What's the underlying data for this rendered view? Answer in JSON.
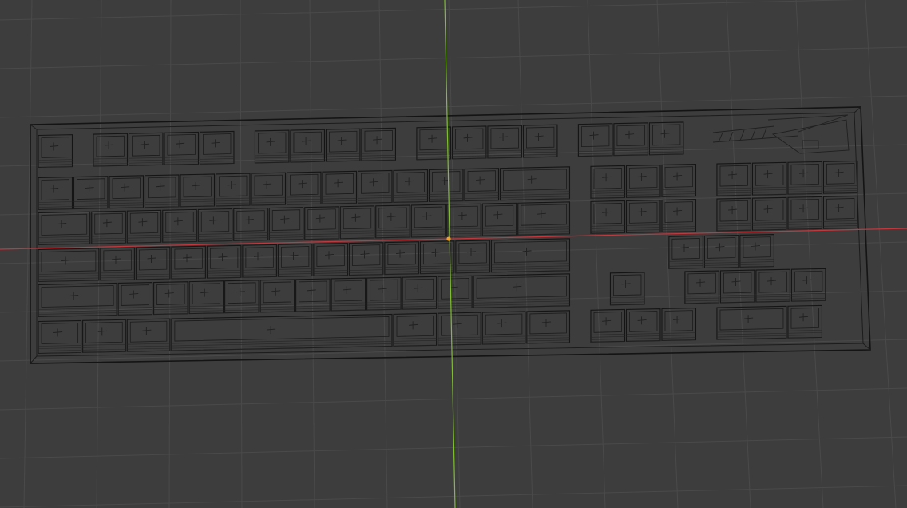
{
  "viewport": {
    "mode": "wireframe",
    "background": "#3d3d3d",
    "grid_color": "#4a4a4a",
    "wire_color": "#151515",
    "axis_x_color": "#c0393f",
    "axis_y_color": "#7fbf2f",
    "origin_color": "#f0a030"
  },
  "model": {
    "object": "keyboard",
    "rows": [
      [
        1,
        0,
        1,
        1,
        1,
        1,
        0,
        1,
        1,
        1,
        1,
        0,
        1,
        1,
        1,
        1,
        0,
        1,
        1,
        1
      ],
      [
        1,
        1,
        1,
        1,
        1,
        1,
        1,
        1,
        1,
        1,
        1,
        1,
        1,
        2,
        0,
        1,
        1,
        1,
        0,
        1,
        1,
        1,
        1
      ],
      [
        1.5,
        1,
        1,
        1,
        1,
        1,
        1,
        1,
        1,
        1,
        1,
        1,
        1,
        1.5,
        0,
        1,
        1,
        1,
        0,
        1,
        1,
        1,
        1
      ],
      [
        1.75,
        1,
        1,
        1,
        1,
        1,
        1,
        1,
        1,
        1,
        1,
        1,
        2.25,
        0,
        0,
        0,
        0,
        0,
        1,
        1,
        1,
        0
      ],
      [
        2.25,
        1,
        1,
        1,
        1,
        1,
        1,
        1,
        1,
        1,
        1,
        2.75,
        0,
        0,
        1,
        0,
        0,
        1,
        1,
        1,
        1
      ],
      [
        1.25,
        1.25,
        1.25,
        6.25,
        1.25,
        1.25,
        1.25,
        1.25,
        0,
        1,
        1,
        1,
        0,
        2,
        1,
        0
      ]
    ]
  }
}
